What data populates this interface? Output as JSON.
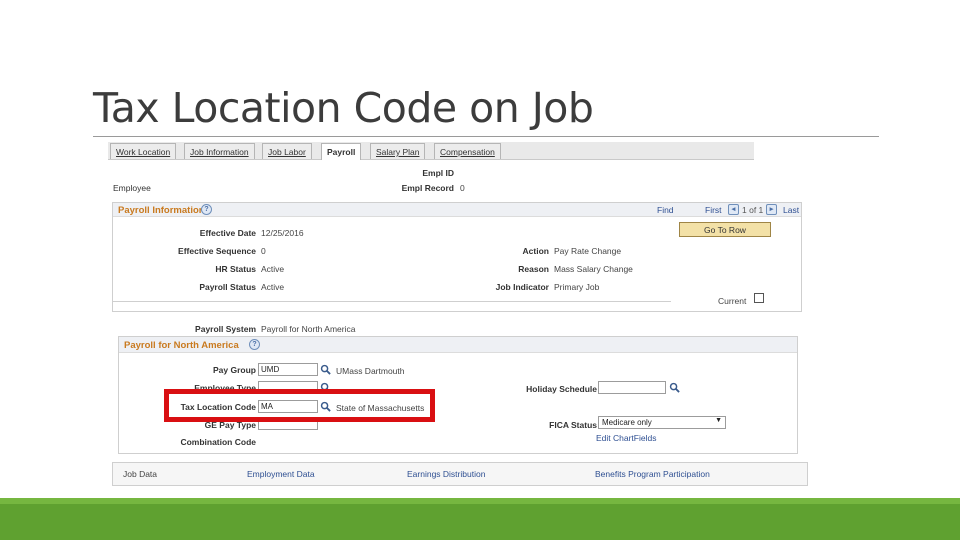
{
  "slide": {
    "title": "Tax Location Code on Job"
  },
  "colors": {
    "accent_green": "#5fa130",
    "highlight_red": "#d90f12",
    "section_orange": "#c97a1f",
    "link_blue": "#2e4f92"
  },
  "tabs": [
    {
      "label": "Work Location",
      "active": false
    },
    {
      "label": "Job Information",
      "active": false
    },
    {
      "label": "Job Labor",
      "active": false
    },
    {
      "label": "Payroll",
      "active": true
    },
    {
      "label": "Salary Plan",
      "active": false
    },
    {
      "label": "Compensation",
      "active": false
    }
  ],
  "header": {
    "employee_label": "Employee",
    "empl_id_label": "Empl ID",
    "empl_record_label": "Empl Record",
    "empl_record_value": "0"
  },
  "payroll_info": {
    "title": "Payroll Information",
    "help_icon": "help-icon",
    "find": "Find",
    "first": "First",
    "count": "1 of 1",
    "last": "Last",
    "go_to_row": "Go To Row",
    "effective_date_label": "Effective Date",
    "effective_date": "12/25/2016",
    "effective_sequence_label": "Effective Sequence",
    "effective_sequence": "0",
    "hr_status_label": "HR Status",
    "hr_status": "Active",
    "payroll_status_label": "Payroll Status",
    "payroll_status": "Active",
    "action_label": "Action",
    "action": "Pay Rate Change",
    "reason_label": "Reason",
    "reason": "Mass Salary Change",
    "job_indicator_label": "Job Indicator",
    "job_indicator": "Primary Job",
    "current_label": "Current"
  },
  "payroll_system": {
    "label": "Payroll System",
    "value": "Payroll for North America"
  },
  "pna": {
    "title": "Payroll for North America",
    "pay_group_label": "Pay Group",
    "pay_group": "UMD",
    "pay_group_desc": "UMass Dartmouth",
    "employee_type_label": "Employee Type",
    "tax_location_label": "Tax Location Code",
    "tax_location": "MA",
    "tax_location_desc": "State of Massachusetts",
    "ge_pay_type_label": "GE Pay Type",
    "combination_code_label": "Combination Code",
    "holiday_schedule_label": "Holiday Schedule",
    "fica_status_label": "FICA Status",
    "fica_status": "Medicare only",
    "edit_chartfields": "Edit ChartFields"
  },
  "footer": {
    "links": [
      "Job Data",
      "Employment Data",
      "Earnings Distribution",
      "Benefits Program Participation"
    ]
  }
}
